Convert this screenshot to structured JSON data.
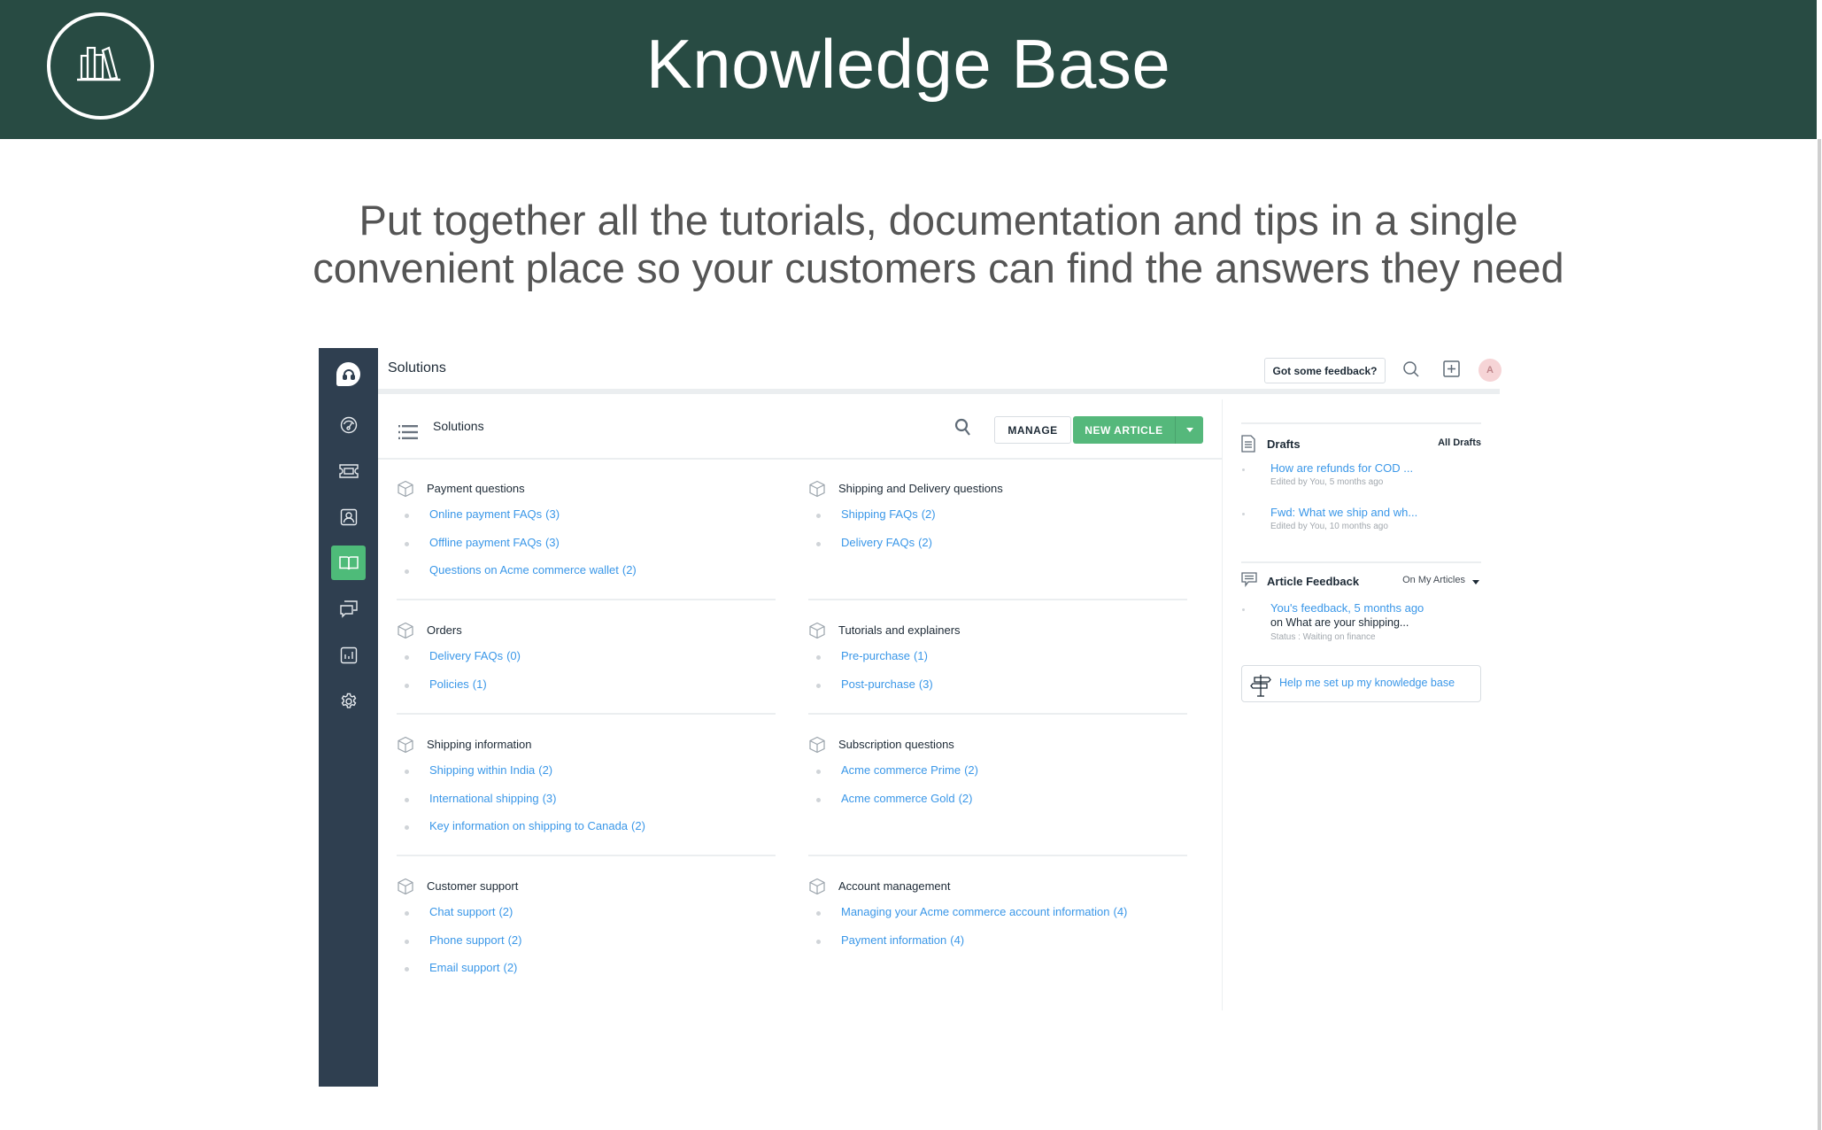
{
  "banner": {
    "title": "Knowledge Base",
    "logo_icon": "books-on-shelf-icon",
    "background": "#284b43"
  },
  "subtitle": {
    "line1": "Put together all the tutorials, documentation and tips in a single",
    "line2": "convenient place so your customers can find the answers they need"
  },
  "app": {
    "sidebar": {
      "items": [
        {
          "icon": "brand-headset-icon",
          "active": false
        },
        {
          "icon": "dashboard-gauge-icon",
          "active": false
        },
        {
          "icon": "ticket-icon",
          "active": false
        },
        {
          "icon": "contacts-icon",
          "active": false
        },
        {
          "icon": "book-open-icon",
          "active": true
        },
        {
          "icon": "conversations-icon",
          "active": false
        },
        {
          "icon": "reports-icon",
          "active": false
        },
        {
          "icon": "settings-gear-icon",
          "active": false
        }
      ],
      "active_color": "#4ebb79"
    },
    "topbar": {
      "title": "Solutions",
      "feedback_label": "Got some feedback?",
      "avatar_initial": "A"
    },
    "toolbar": {
      "title": "Solutions",
      "manage_label": "MANAGE",
      "new_article_label": "NEW ARTICLE"
    },
    "categories": [
      {
        "title": "Payment questions",
        "folders": [
          {
            "name": "Online payment FAQs",
            "count": "(3)"
          },
          {
            "name": "Offline payment FAQs",
            "count": "(3)"
          },
          {
            "name": "Questions on Acme commerce wallet",
            "count": "(2)"
          }
        ]
      },
      {
        "title": "Shipping and Delivery questions",
        "folders": [
          {
            "name": "Shipping FAQs",
            "count": "(2)"
          },
          {
            "name": "Delivery FAQs",
            "count": "(2)"
          }
        ]
      },
      {
        "title": "Orders",
        "folders": [
          {
            "name": "Delivery FAQs",
            "count": "(0)"
          },
          {
            "name": "Policies",
            "count": "(1)"
          }
        ]
      },
      {
        "title": "Tutorials and explainers",
        "folders": [
          {
            "name": "Pre-purchase",
            "count": "(1)"
          },
          {
            "name": "Post-purchase",
            "count": "(3)"
          }
        ]
      },
      {
        "title": "Shipping information",
        "folders": [
          {
            "name": "Shipping within India",
            "count": "(2)"
          },
          {
            "name": "International shipping",
            "count": "(3)"
          },
          {
            "name": "Key information on shipping to Canada",
            "count": "(2)"
          }
        ]
      },
      {
        "title": "Subscription questions",
        "folders": [
          {
            "name": "Acme commerce Prime",
            "count": "(2)"
          },
          {
            "name": "Acme commerce Gold",
            "count": "(2)"
          }
        ]
      },
      {
        "title": "Customer support",
        "folders": [
          {
            "name": "Chat support",
            "count": "(2)"
          },
          {
            "name": "Phone support",
            "count": "(2)"
          },
          {
            "name": "Email support",
            "count": "(2)"
          }
        ]
      },
      {
        "title": "Account management",
        "folders": [
          {
            "name": "Managing your Acme commerce account information",
            "count": "(4)"
          },
          {
            "name": "Payment information",
            "count": "(4)"
          }
        ]
      }
    ],
    "drafts": {
      "title": "Drafts",
      "action": "All Drafts",
      "items": [
        {
          "title": "How are refunds for COD ...",
          "meta": "Edited by You, 5 months ago"
        },
        {
          "title": "Fwd: What we ship and wh...",
          "meta": "Edited by You, 10 months ago"
        }
      ]
    },
    "feedback": {
      "title": "Article Feedback",
      "filter": "On My Articles",
      "items": [
        {
          "title": "You's feedback, 5 months ago",
          "article": "on What are your shipping...",
          "status": "Status : Waiting on finance"
        }
      ]
    },
    "help_label": "Help me set up my knowledge base",
    "colors": {
      "link": "#3a97e8",
      "primary_button": "#55b87b",
      "sidebar": "#2f3f50"
    }
  }
}
